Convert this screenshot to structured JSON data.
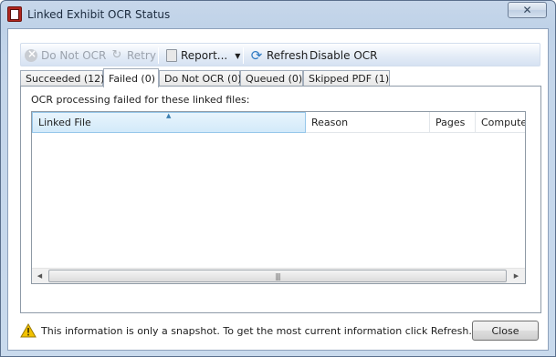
{
  "window": {
    "title": "Linked Exhibit OCR Status",
    "close_glyph": "✕"
  },
  "toolbar": {
    "do_not_ocr": "Do Not OCR",
    "retry": "Retry",
    "report": "Report...",
    "refresh": "Refresh",
    "disable_ocr": "Disable OCR"
  },
  "tabs": [
    {
      "label": "Succeeded (12)",
      "active": false
    },
    {
      "label": "Failed (0)",
      "active": true
    },
    {
      "label": "Do Not OCR (0)",
      "active": false
    },
    {
      "label": "Queued (0)",
      "active": false
    },
    {
      "label": "Skipped PDF (1)",
      "active": false
    }
  ],
  "panel": {
    "label": "OCR processing failed for these linked files:"
  },
  "grid": {
    "columns": [
      "Linked File",
      "Reason",
      "Pages",
      "Computer"
    ],
    "sorted_column": "Linked File",
    "rows": []
  },
  "footer": {
    "message": "This information is only a snapshot.  To get the most current information click Refresh.",
    "close_label": "Close"
  },
  "colors": {
    "accent": "#96c7ea",
    "warning": "#f2c200"
  }
}
